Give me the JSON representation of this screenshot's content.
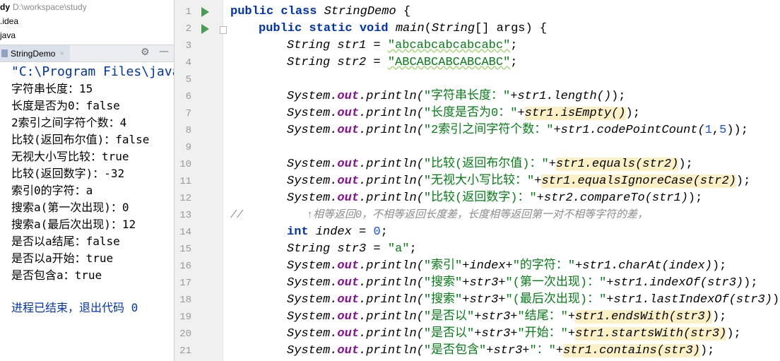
{
  "project": {
    "root_name": "dy",
    "root_path": "D:\\workspace\\study",
    "items": [
      ".idea",
      "java"
    ]
  },
  "run_panel": {
    "tab_label": "StringDemo",
    "close_glyph": "×",
    "settings_icon": "gear-icon",
    "minimize_icon": "minimize-icon"
  },
  "console": {
    "command": "\"C:\\Program Files\\java",
    "output": [
      "字符串长度：15",
      "长度是否为0：false",
      "2索引之间字符个数：4",
      "比较(返回布尔值)：false",
      "无视大小写比较：true",
      "比较(返回数字)：-32",
      "索引0的字符：a",
      "搜索a(第一次出现)：0",
      "搜索a(最后次出现)：12",
      "是否以a结尾：false",
      "是否以a开始：true",
      "是否包含a：true"
    ],
    "exit_message": "进程已结束，退出代码 0"
  },
  "gutter": {
    "line_numbers": [
      "1",
      "2",
      "3",
      "4",
      "5",
      "6",
      "7",
      "8",
      "9",
      "10",
      "11",
      "12",
      "13",
      "14",
      "15",
      "16",
      "17",
      "18",
      "19",
      "20",
      "21"
    ]
  },
  "code": {
    "l1": {
      "kw": "public class ",
      "cls": "StringDemo",
      "rest": " {"
    },
    "l2": {
      "kw": "public static void ",
      "m": "main",
      "p1": "(",
      "t": "String",
      "p2": "[] args) {"
    },
    "l3": {
      "t": "String ",
      "v": "str1",
      "eq": " = ",
      "s": "\"abcabcabcabcabc\"",
      "end": ";"
    },
    "l4": {
      "t": "String ",
      "v": "str2",
      "eq": " = ",
      "s": "\"ABCABCABCABCABC\"",
      "end": ";"
    },
    "sys": "System.",
    "out": "out",
    "println": ".println(",
    "l6": {
      "s": "\"字符串长度：\"",
      "plus": "+",
      "expr": "str1.length()",
      "end": ");"
    },
    "l7": {
      "s": "\"长度是否为0：\"",
      "plus": "+",
      "expr": "str1.isEmpty()",
      "end": ");"
    },
    "l8": {
      "s": "\"2索引之间字符个数：\"",
      "plus": "+",
      "e1": "str1.codePointCount(",
      "n1": "1",
      "c": ",",
      "n2": "5",
      "end": "));"
    },
    "l10": {
      "s": "\"比较(返回布尔值)：\"",
      "plus": "+",
      "expr": "str1.equals(str2)",
      "end": ");"
    },
    "l11": {
      "s": "\"无视大小写比较：\"",
      "plus": "+",
      "expr": "str1.equalsIgnoreCase(str2)",
      "end": ");"
    },
    "l12": {
      "s": "\"比较(返回数字)：\"",
      "plus": "+",
      "expr": "str2.compareTo(str1)",
      "end": ");"
    },
    "l13": {
      "cm": "//          ↑相等返回0，不相等返回长度差，长度相等返回第一对不相等字符的差，"
    },
    "l14": {
      "kw": "int ",
      "v": "index",
      "eq": " = ",
      "n": "0",
      "end": ";"
    },
    "l15": {
      "t": "String ",
      "v": "str3",
      "eq": " = ",
      "s": "\"a\"",
      "end": ";"
    },
    "l16": {
      "s1": "\"索引\"",
      "p1": "+",
      "v1": "index",
      "p2": "+",
      "s2": "\"的字符：\"",
      "p3": "+",
      "expr": "str1.charAt(index)",
      "end": ");"
    },
    "l17": {
      "s1": "\"搜索\"",
      "p1": "+",
      "v1": "str3",
      "p2": "+",
      "s2": "\"(第一次出现)：\"",
      "p3": "+",
      "expr": "str1.indexOf(str3)",
      "end": ");"
    },
    "l18": {
      "s1": "\"搜索\"",
      "p1": "+",
      "v1": "str3",
      "p2": "+",
      "s2": "\"(最后次出现)：\"",
      "p3": "+",
      "expr": "str1.lastIndexOf(str3)",
      "end": ");"
    },
    "l19": {
      "s1": "\"是否以\"",
      "p1": "+",
      "v1": "str3",
      "p2": "+",
      "s2": "\"结尾：\"",
      "p3": "+",
      "expr": "str1.endsWith(str3)",
      "end": ");"
    },
    "l20": {
      "s1": "\"是否以\"",
      "p1": "+",
      "v1": "str3",
      "p2": "+",
      "s2": "\"开始：\"",
      "p3": "+",
      "expr": "str1.startsWith(str3)",
      "end": ");"
    },
    "l21": {
      "s1": "\"是否包含\"",
      "p1": "+",
      "v1": "str3",
      "p2": "+",
      "s2": "\"：\"",
      "p3": "+",
      "expr": "str1.contains(str3)",
      "end": ");"
    }
  },
  "colors": {
    "keyword": "#0033b3",
    "string": "#067d17",
    "field": "#871094",
    "number": "#1750eb",
    "comment": "#8c8c8c",
    "highlight": "#fdf0c5",
    "run_arrow": "#499c54"
  }
}
